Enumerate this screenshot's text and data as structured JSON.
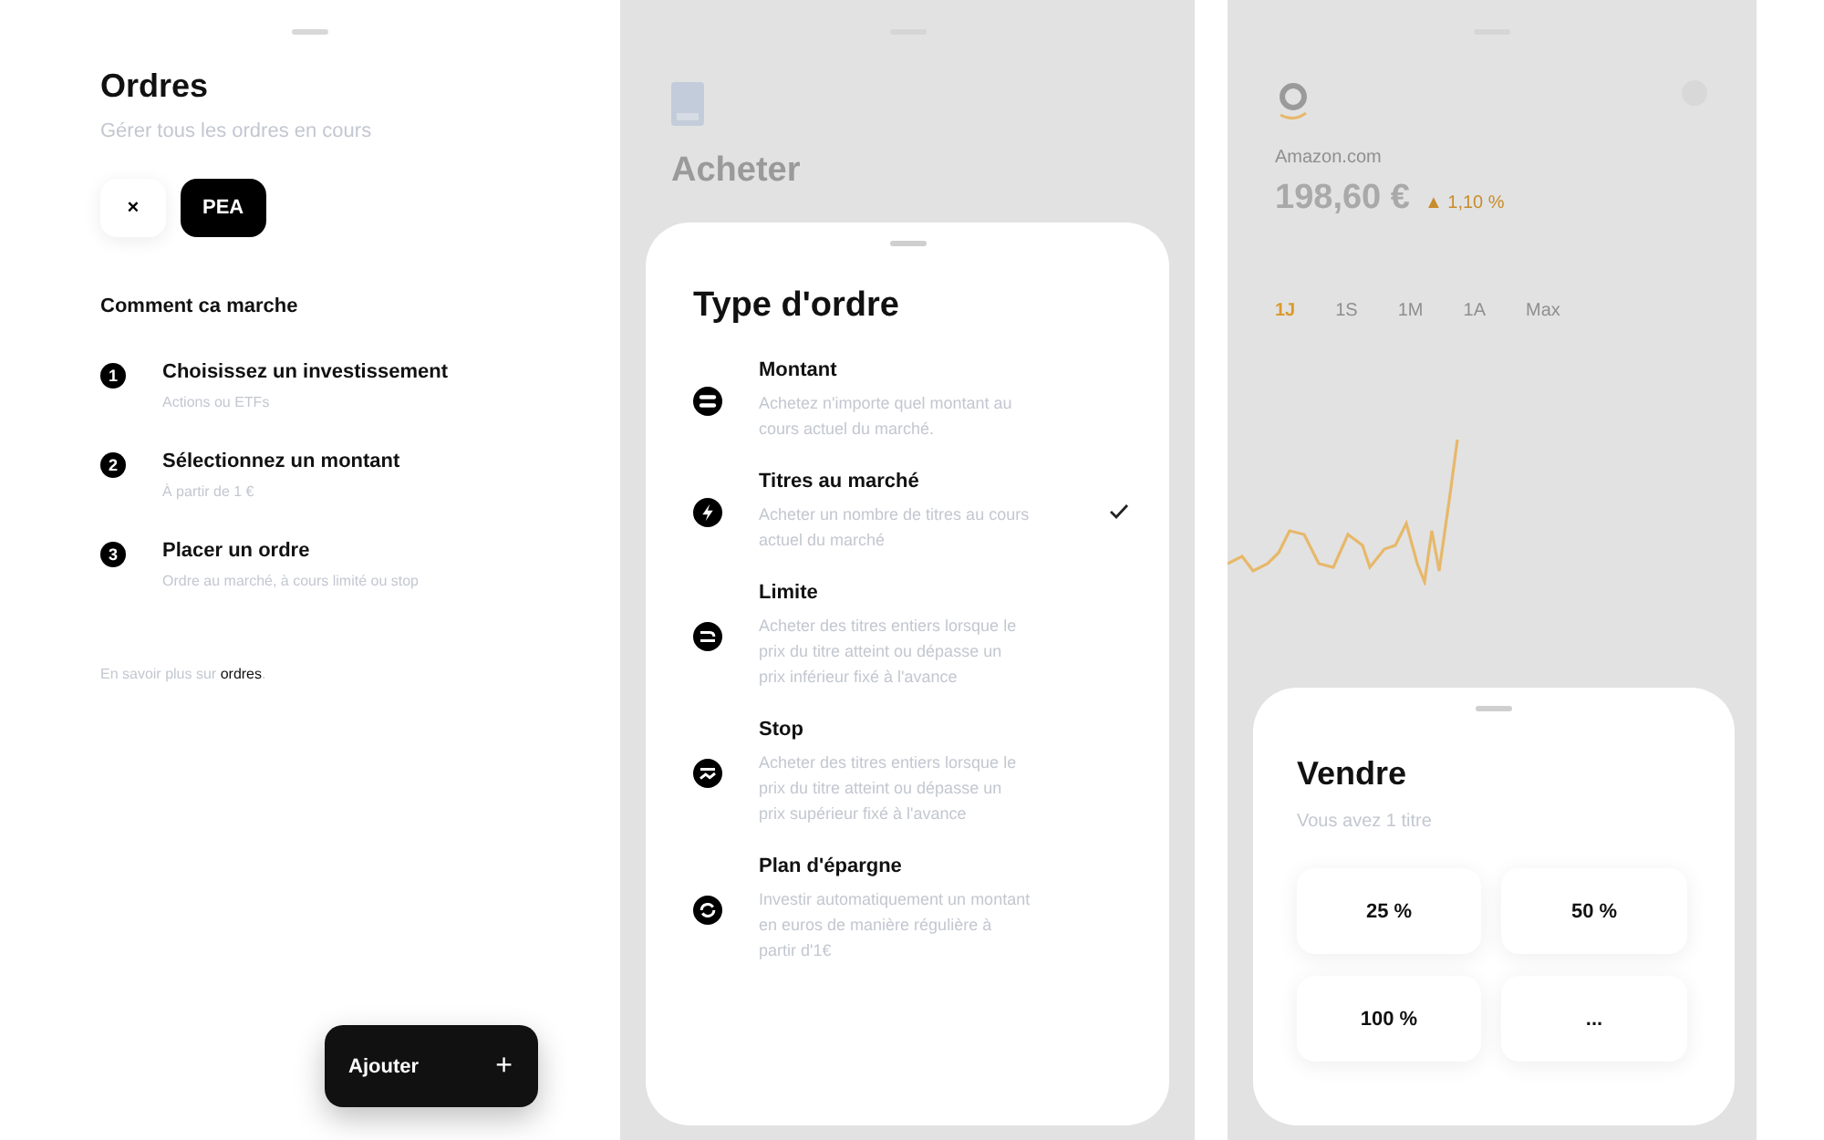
{
  "orders_screen": {
    "title": "Ordres",
    "subtitle": "Gérer tous les ordres en cours",
    "chips": [
      {
        "label": "×",
        "selected": false
      },
      {
        "label": "PEA",
        "selected": true
      }
    ],
    "section_title": "Comment ca marche",
    "steps": [
      {
        "number": "1",
        "title": "Choisissez un investissement",
        "description": "Actions ou ETFs"
      },
      {
        "number": "2",
        "title": "Sélectionnez un montant",
        "description": "À partir de 1 €"
      },
      {
        "number": "3",
        "title": "Placer un ordre",
        "description": "Ordre au marché, à cours limité ou stop"
      }
    ],
    "learn_more": {
      "text": "En savoir plus sur",
      "link": "ordres",
      "suffix": "."
    },
    "add_button": {
      "label": "Ajouter",
      "icon": "+"
    }
  },
  "buy_screen": {
    "title": "Acheter",
    "sheet": {
      "title": "Type d'ordre",
      "options": [
        {
          "kind": "amount",
          "title": "Montant",
          "description": "Achetez n'importe quel montant au cours actuel du marché.",
          "selected": false
        },
        {
          "kind": "market",
          "title": "Titres au marché",
          "description": "Acheter un nombre de titres au cours actuel du marché",
          "selected": true
        },
        {
          "kind": "limit",
          "title": "Limite",
          "description": "Acheter des titres entiers lorsque le prix du titre atteint ou dépasse un prix inférieur fixé à l'avance",
          "selected": false
        },
        {
          "kind": "stop",
          "title": "Stop",
          "description": "Acheter des titres entiers lorsque le prix du titre atteint ou dépasse un prix supérieur fixé à l'avance",
          "selected": false
        },
        {
          "kind": "plan",
          "title": "Plan d'épargne",
          "description": "Investir automatiquement un montant en euros de manière régulière à partir d'1€",
          "selected": false
        }
      ]
    }
  },
  "stock_screen": {
    "company": "Amazon.com",
    "price": "198,60 €",
    "change": "▲ 1,10 %",
    "periods": [
      {
        "label": "1J",
        "selected": true
      },
      {
        "label": "1S",
        "selected": false
      },
      {
        "label": "1M",
        "selected": false
      },
      {
        "label": "1A",
        "selected": false
      },
      {
        "label": "Max",
        "selected": false
      }
    ],
    "sheet": {
      "title": "Vendre",
      "subtitle": "Vous avez 1 titre",
      "amounts": [
        "25 %",
        "50 %",
        "100 %",
        "..."
      ]
    }
  }
}
